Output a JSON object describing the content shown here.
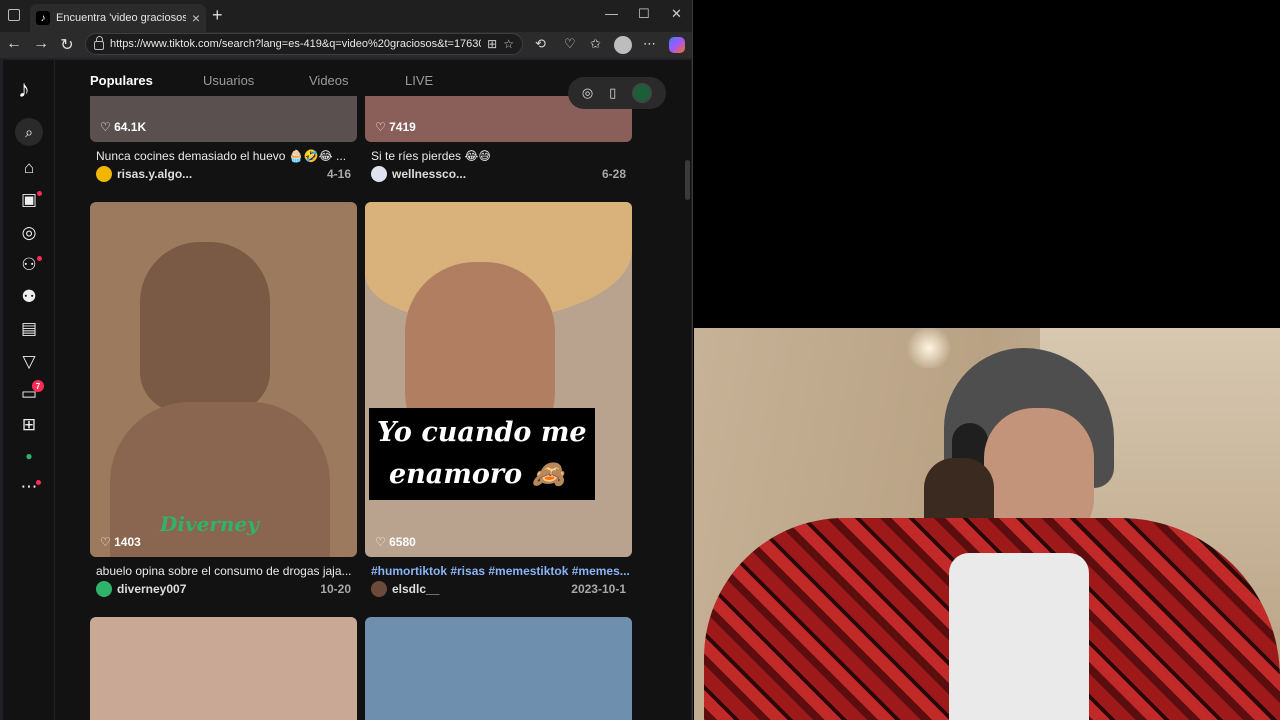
{
  "browser": {
    "tab_title": "Encuentra 'video graciosos' en Ti",
    "url": "https://www.tiktok.com/search?lang=es-419&q=video%20graciosos&t=17630..."
  },
  "tiktok": {
    "tabs": [
      "Populares",
      "Usuarios",
      "Videos",
      "LIVE"
    ],
    "nav_badge_count": "7",
    "cards": [
      {
        "likes": "64.1K",
        "caption": "Nunca cocines demasiado el huevo 🧁🤣😂 ...",
        "author": "risas.y.algo...",
        "date": "4-16",
        "thumb_color": "#5a5050"
      },
      {
        "likes": "7419",
        "caption": "Si te ríes pierdes 😂😅",
        "author": "wellnessco...",
        "date": "6-28",
        "thumb_color": "#8a5f5a"
      },
      {
        "likes": "1403",
        "caption": "abuelo opina sobre el consumo de drogas jaja...",
        "author": "diverney007",
        "date": "10-20",
        "thumb_color": "#9c7a5e",
        "sticker_text": "Diverney"
      },
      {
        "likes": "6580",
        "caption": "#humortiktok #risas #memestiktok #memes...",
        "author": "elsdlc__",
        "date": "2023-10-1",
        "thumb_color": "#b9a38e",
        "overlay_line1": "Yo cuando me",
        "overlay_line2": "enamoro 🙈"
      },
      {
        "thumb_color": "#c9a896"
      },
      {
        "thumb_color": "#6f8fae"
      }
    ]
  }
}
